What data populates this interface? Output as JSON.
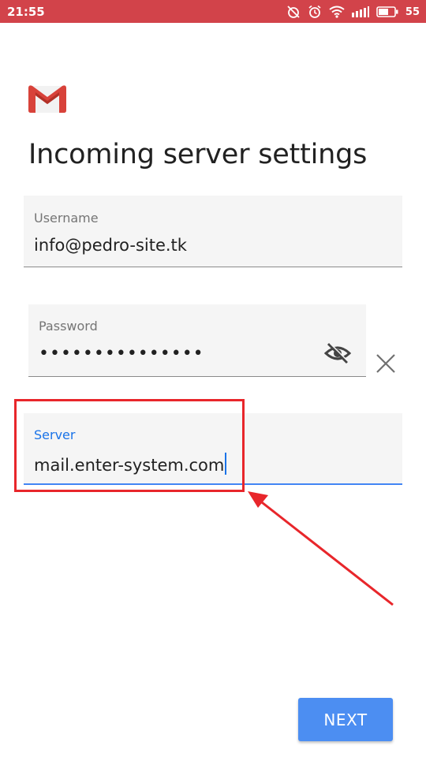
{
  "status_bar": {
    "time": "21:55",
    "battery_percent": "55",
    "icons": [
      "alarm-off-icon",
      "alarm-icon",
      "wifi-icon",
      "signal-icon",
      "battery-icon"
    ],
    "background": "#d2434a"
  },
  "app": {
    "logo": "gmail-logo"
  },
  "page": {
    "title": "Incoming server settings"
  },
  "form": {
    "username": {
      "label": "Username",
      "value": "info@pedro-site.tk"
    },
    "password": {
      "label": "Password",
      "value": "•••••••••••••••"
    },
    "server": {
      "label": "Server",
      "value": "mail.enter-system.com"
    }
  },
  "actions": {
    "next_label": "NEXT"
  },
  "colors": {
    "accent": "#4285f4",
    "button": "#4c8ef2",
    "annotation": "#e8262b"
  }
}
